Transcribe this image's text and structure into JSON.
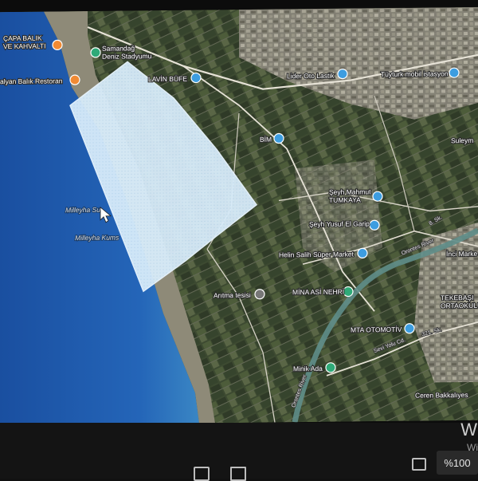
{
  "map": {
    "pois": [
      {
        "id": "capa",
        "label_line1": "ÇAPA BALIK",
        "label_line2": "VE KAHVALTI"
      },
      {
        "id": "samandag",
        "label_line1": "Samandağ",
        "label_line2": "Deniz Stadyumu"
      },
      {
        "id": "alyan",
        "label": "alyan Balık Restoran"
      },
      {
        "id": "lavin",
        "label": "LAVİN BÜFE"
      },
      {
        "id": "lider",
        "label": "Lider Oto Lastik"
      },
      {
        "id": "tuyturk",
        "label": "Tüyturk mobil istasyon"
      },
      {
        "id": "bim",
        "label": "BİM"
      },
      {
        "id": "suleyman",
        "label": "Suleym"
      },
      {
        "id": "seyh_mahmut",
        "label_line1": "Şeyh Mahmut",
        "label_line2": "TUMKAYA"
      },
      {
        "id": "seyh_yusuf",
        "label": "Şeyh Yusuf El Garip"
      },
      {
        "id": "helin",
        "label": "Helin Salih Süper Market"
      },
      {
        "id": "inci",
        "label": "İnci Marke"
      },
      {
        "id": "aritma",
        "label": "Arıtma tesisi"
      },
      {
        "id": "mina",
        "label": "MİNA ASİ NEHRİ"
      },
      {
        "id": "tekebasi",
        "label_line1": "TEKEBAŞI",
        "label_line2": "ORTAOKULU"
      },
      {
        "id": "mta",
        "label": "MTA OTOMOTİV"
      },
      {
        "id": "minik",
        "label": "Minik Ada"
      },
      {
        "id": "ceren",
        "label": "Ceren Bakkalıyes"
      }
    ],
    "water_labels": [
      "Milleyha Su",
      "Milleyha Kums"
    ],
    "road_labels": [
      "Orontes River",
      "Orontes River",
      "Sevi Yolu Cd.",
      "321. Sk.",
      "8. Sk."
    ],
    "colors": {
      "sea": "#1f5fb0",
      "selection": "#cfe6f7",
      "land": "#3e4a33",
      "poi_blue": "#3d9de0",
      "poi_green": "#2faa78",
      "poi_orange": "#f08a34"
    }
  },
  "taskbar": {
    "watermark_title": "W",
    "watermark_sub": "Wi",
    "zoom_level": "%100"
  }
}
